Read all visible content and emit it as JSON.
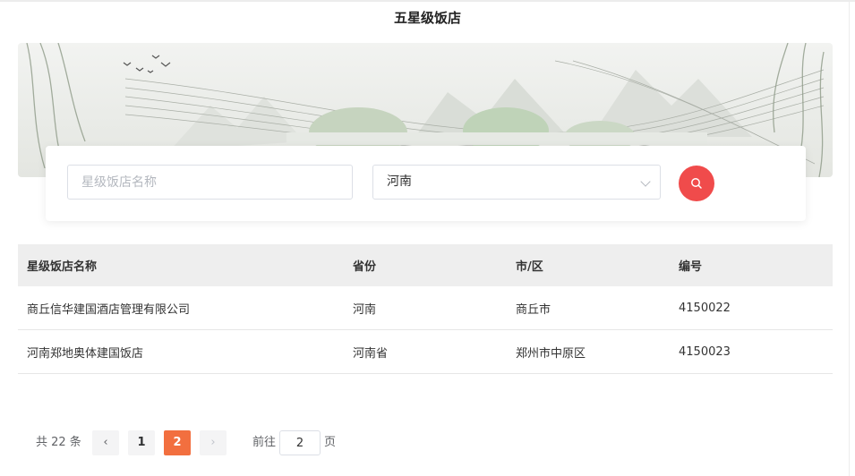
{
  "page_title": "五星级饭店",
  "search": {
    "name_placeholder": "星级饭店名称",
    "name_value": "",
    "province_value": "河南"
  },
  "table": {
    "headers": [
      "星级饭店名称",
      "省份",
      "市/区",
      "编号"
    ],
    "rows": [
      [
        "商丘信华建国酒店管理有限公司",
        "河南",
        "商丘市",
        "4150022"
      ],
      [
        "河南郑地奥体建国饭店",
        "河南省",
        "郑州市中原区",
        "4150023"
      ]
    ]
  },
  "pagination": {
    "total": "共 22 条",
    "pages": [
      "1",
      "2"
    ],
    "current_page": "2",
    "jump_prefix": "前往",
    "jump_value": "2",
    "jump_suffix": "页"
  },
  "colors": {
    "accent_red": "#f04b4b",
    "page_active": "#f26f3f",
    "header_bg": "#eeeeee"
  },
  "icons": {
    "search": "search-icon",
    "select": "chevron-down-icon",
    "prev": "chevron-left-icon",
    "next": "chevron-right-icon"
  }
}
